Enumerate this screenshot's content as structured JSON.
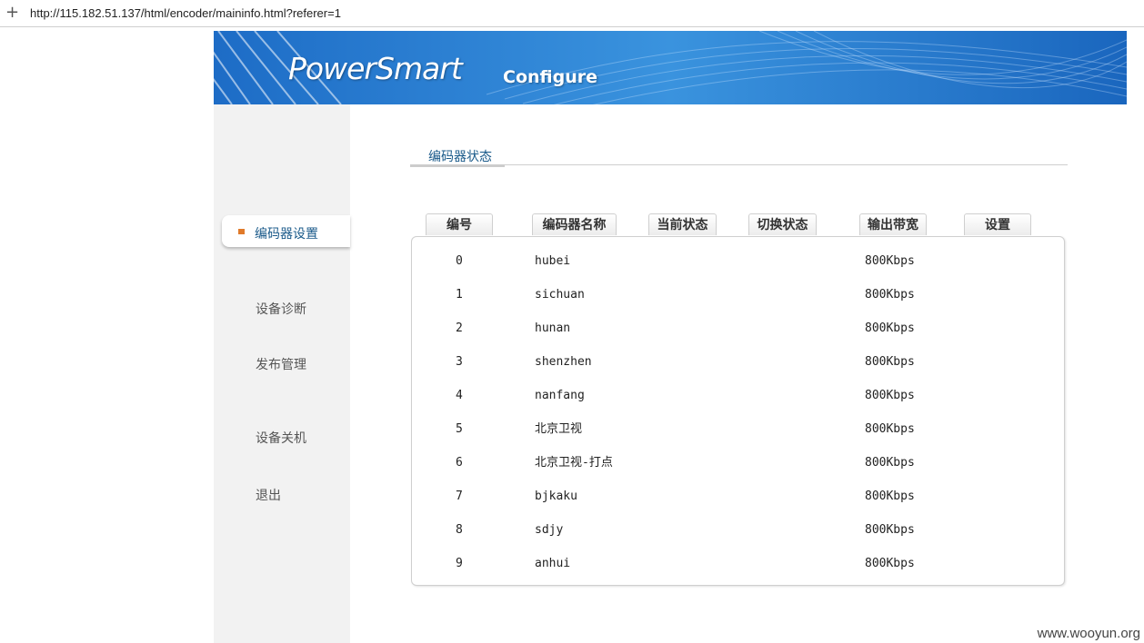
{
  "browser": {
    "new_tab_symbol": "+",
    "url": "http://115.182.51.137/html/encoder/maininfo.html?referer=1"
  },
  "banner": {
    "logo_text": "PowerSmart",
    "subtitle": "Configure"
  },
  "sidebar": {
    "items": [
      {
        "label": "编码器设置",
        "active": true
      },
      {
        "label": "设备诊断",
        "active": false
      },
      {
        "label": "发布管理",
        "active": false
      },
      {
        "label": "设备关机",
        "active": false
      },
      {
        "label": "退出",
        "active": false
      }
    ]
  },
  "main": {
    "tab_title": "编码器状态",
    "columns": [
      "编号",
      "编码器名称",
      "当前状态",
      "切换状态",
      "输出带宽",
      "设置"
    ],
    "rows": [
      {
        "id": "0",
        "name": "hubei",
        "status": "",
        "switch": "",
        "bandwidth": "800Kbps"
      },
      {
        "id": "1",
        "name": "sichuan",
        "status": "",
        "switch": "",
        "bandwidth": "800Kbps"
      },
      {
        "id": "2",
        "name": "hunan",
        "status": "",
        "switch": "",
        "bandwidth": "800Kbps"
      },
      {
        "id": "3",
        "name": "shenzhen",
        "status": "",
        "switch": "",
        "bandwidth": "800Kbps"
      },
      {
        "id": "4",
        "name": "nanfang",
        "status": "",
        "switch": "",
        "bandwidth": "800Kbps"
      },
      {
        "id": "5",
        "name": "北京卫视",
        "status": "",
        "switch": "",
        "bandwidth": "800Kbps"
      },
      {
        "id": "6",
        "name": "北京卫视-打点",
        "status": "",
        "switch": "",
        "bandwidth": "800Kbps"
      },
      {
        "id": "7",
        "name": "bjkaku",
        "status": "",
        "switch": "",
        "bandwidth": "800Kbps"
      },
      {
        "id": "8",
        "name": "sdjy",
        "status": "",
        "switch": "",
        "bandwidth": "800Kbps"
      },
      {
        "id": "9",
        "name": "anhui",
        "status": "",
        "switch": "",
        "bandwidth": "800Kbps"
      }
    ]
  },
  "watermark": "www.wooyun.org",
  "colors": {
    "banner_blue": "#2f86d8",
    "active_bullet": "#e07a2a",
    "link_blue": "#1a5a8a",
    "sidebar_bg": "#f2f2f2"
  }
}
